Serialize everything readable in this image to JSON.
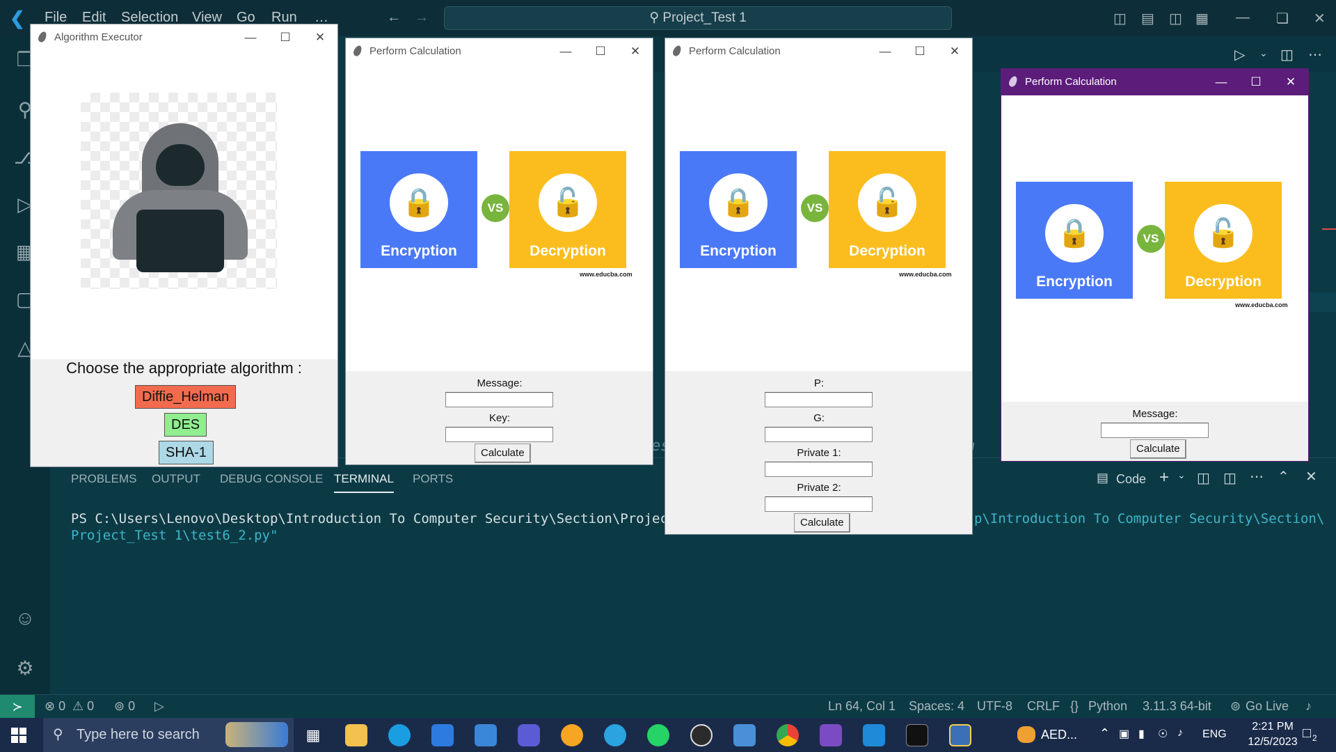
{
  "vscode": {
    "menu": [
      "File",
      "Edit",
      "Selection",
      "View",
      "Go",
      "Run",
      "…"
    ],
    "search_box": "Project_Test 1",
    "panel_tabs": [
      "PROBLEMS",
      "OUTPUT",
      "DEBUG CONSOLE",
      "TERMINAL",
      "PORTS"
    ],
    "terminal_shell": "Code",
    "terminal_line1_left": "PS C:\\Users\\Lenovo\\Desktop\\Introduction To Computer Security\\Section\\Project_T",
    "terminal_line1_right": "p\\Introduction To Computer Security\\Section\\",
    "terminal_line2": "Project_Test 1\\test6_2.py\"",
    "editor_ghost_text_1": "es",
    "editor_ghost_text_2": "ch",
    "status": {
      "errors": "0",
      "warnings": "0",
      "ports": "0",
      "position": "Ln 64, Col 1",
      "spaces": "Spaces: 4",
      "encoding": "UTF-8",
      "eol": "CRLF",
      "language": "Python",
      "interpreter": "3.11.3 64-bit",
      "golive": "Go Live"
    }
  },
  "taskbar": {
    "search_placeholder": "Type here to search",
    "weather": "AED...",
    "lang": "ENG",
    "time": "2:21 PM",
    "date": "12/5/2023",
    "notifications": "2"
  },
  "algorithm_window": {
    "title": "Algorithm Executor",
    "prompt": "Choose the appropriate algorithm :",
    "buttons": [
      "Diffie_Helman",
      "DES",
      "SHA-1"
    ],
    "button_colors": [
      "#f26b4e",
      "#90ee90",
      "#add8e6"
    ]
  },
  "calc_windows": [
    {
      "title": "Perform Calculation",
      "image": {
        "left_label": "Encryption",
        "right_label": "Decryption",
        "vs": "VS",
        "source": "www.educba.com"
      },
      "fields": [
        "Message:",
        "Key:"
      ],
      "button": "Calculate"
    },
    {
      "title": "Perform Calculation",
      "image": {
        "left_label": "Encryption",
        "right_label": "Decryption",
        "vs": "VS",
        "source": "www.educba.com"
      },
      "fields": [
        "P:",
        "G:",
        "Private 1:",
        "Private 2:"
      ],
      "button": "Calculate"
    },
    {
      "title": "Perform Calculation",
      "image": {
        "left_label": "Encryption",
        "right_label": "Decryption",
        "vs": "VS",
        "source": "www.educba.com"
      },
      "fields": [
        "Message:"
      ],
      "button": "Calculate"
    }
  ]
}
